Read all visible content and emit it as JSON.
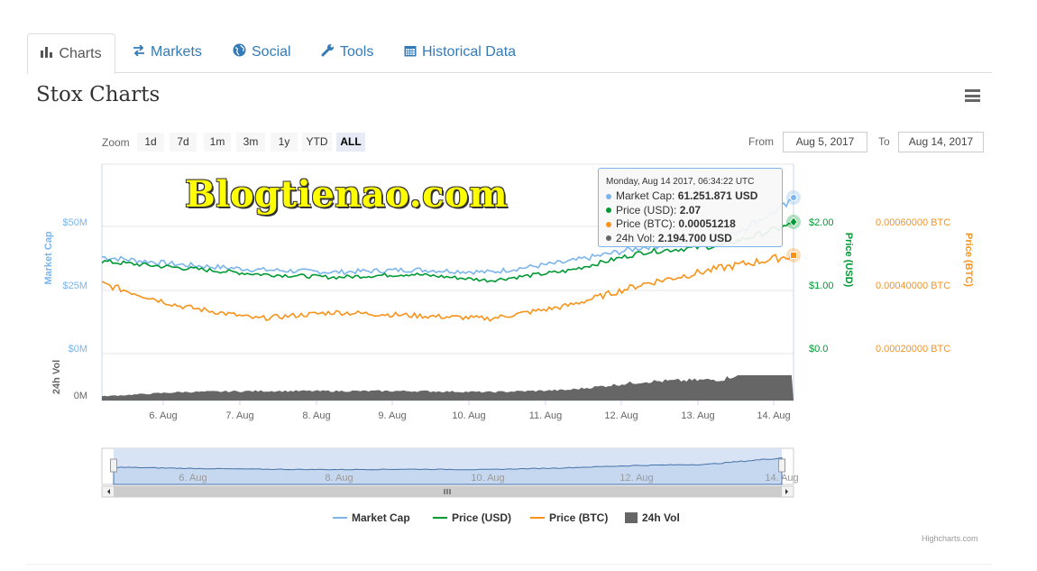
{
  "tabs": [
    {
      "label": "Charts",
      "icon": "bar-chart-icon"
    },
    {
      "label": "Markets",
      "icon": "exchange-icon"
    },
    {
      "label": "Social",
      "icon": "globe-icon"
    },
    {
      "label": "Tools",
      "icon": "wrench-icon"
    },
    {
      "label": "Historical Data",
      "icon": "calendar-icon"
    }
  ],
  "page_title": "Stox Charts",
  "zoom": {
    "label": "Zoom",
    "buttons": [
      "1d",
      "7d",
      "1m",
      "3m",
      "1y",
      "YTD",
      "ALL"
    ],
    "active": "ALL"
  },
  "range": {
    "from_label": "From",
    "from": "Aug 5, 2017",
    "to_label": "To",
    "to": "Aug 14, 2017"
  },
  "watermark": "Blogtienao.com",
  "tooltip": {
    "header": "Monday, Aug 14 2017, 06:34:22 UTC",
    "rows": [
      {
        "label": "Market Cap",
        "value": "61.251.871 USD",
        "color": "#7cb5ec"
      },
      {
        "label": "Price (USD)",
        "value": "2.07",
        "color": "#009933"
      },
      {
        "label": "Price (BTC)",
        "value": "0.00051218",
        "color": "#f7931a"
      },
      {
        "label": "24h Vol",
        "value": "2.194.700 USD",
        "color": "#666666"
      }
    ]
  },
  "legend": [
    {
      "label": "Market Cap",
      "color": "#7cb5ec"
    },
    {
      "label": "Price (USD)",
      "color": "#009933"
    },
    {
      "label": "Price (BTC)",
      "color": "#f7931a"
    },
    {
      "label": "24h Vol",
      "color": "#666666"
    }
  ],
  "credits": "Highcharts.com",
  "chart_data": {
    "type": "line",
    "x": [
      "Aug 5",
      "Aug 6",
      "Aug 7",
      "Aug 8",
      "Aug 9",
      "Aug 10",
      "Aug 11",
      "Aug 12",
      "Aug 13",
      "Aug 14"
    ],
    "xticks": [
      "6. Aug",
      "7. Aug",
      "8. Aug",
      "9. Aug",
      "10. Aug",
      "11. Aug",
      "12. Aug",
      "13. Aug",
      "14. Aug"
    ],
    "navigator_ticks": [
      "6. Aug",
      "8. Aug",
      "10. Aug",
      "12. Aug",
      "14. Aug"
    ],
    "axes": {
      "market_cap": {
        "label": "Market Cap",
        "ticks": [
          "$0M",
          "$25M",
          "$50M"
        ],
        "range": [
          0,
          50
        ]
      },
      "price_usd": {
        "label": "Price (USD)",
        "ticks": [
          "$0.0",
          "$1.00",
          "$2.00"
        ],
        "range": [
          0,
          2
        ]
      },
      "price_btc": {
        "label": "Price (BTC)",
        "ticks": [
          "0.00020000 BTC",
          "0.00040000 BTC",
          "0.00060000 BTC"
        ],
        "range": [
          0.0002,
          0.0006
        ]
      },
      "volume": {
        "label": "24h Vol",
        "ticks": [
          "0M"
        ]
      }
    },
    "series": [
      {
        "name": "Market Cap",
        "values": [
          38,
          35,
          33,
          32,
          33,
          32,
          36,
          42,
          45,
          61
        ]
      },
      {
        "name": "Price (USD)",
        "values": [
          1.45,
          1.35,
          1.25,
          1.2,
          1.25,
          1.15,
          1.3,
          1.6,
          1.7,
          2.07
        ]
      },
      {
        "name": "Price (BTC)",
        "values": [
          0.00042,
          0.00035,
          0.00031,
          0.00033,
          0.00032,
          0.00031,
          0.00035,
          0.00042,
          0.00047,
          0.00051218
        ]
      },
      {
        "name": "24h Vol",
        "values": [
          0.2,
          0.4,
          0.45,
          0.45,
          0.45,
          0.4,
          0.5,
          0.9,
          1.0,
          2.1947
        ]
      }
    ]
  }
}
